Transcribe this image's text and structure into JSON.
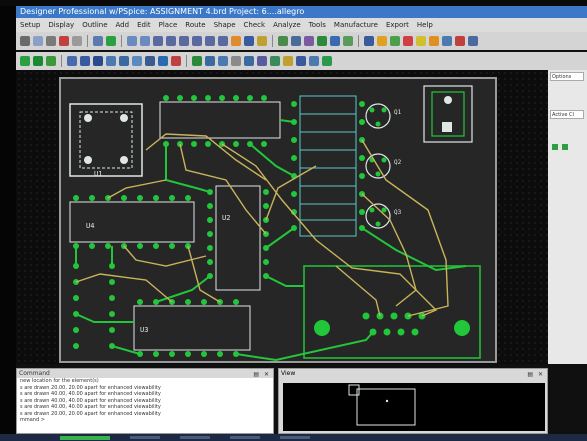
{
  "window": {
    "title": "Designer Professional w/PSpice: ASSIGNMENT 4.brd  Project: 6....allegro"
  },
  "menu": [
    "Setup",
    "Display",
    "Outline",
    "Add",
    "Edit",
    "Place",
    "Route",
    "Shape",
    "Check",
    "Analyze",
    "Tools",
    "Manufacture",
    "Export",
    "Help"
  ],
  "board": {
    "ref_u1": "U1",
    "ref_u2": "U2",
    "ref_u3": "U3",
    "ref_u4": "U4",
    "ref_q1": "Q1",
    "ref_q2": "Q2",
    "ref_q3": "Q3",
    "colors": {
      "copper": "#22c63a",
      "trace": "#c9b45a",
      "silk": "#dfe6e6",
      "board": "#2a2a2a"
    }
  },
  "right_panel": {
    "tabs": [
      "Options",
      "Active Cl"
    ]
  },
  "command_panel": {
    "title": "Command",
    "lines": [
      "new location for the element(s)",
      "s are drawn 20.00, 20.00 apart for enhanced viewability",
      "s are drawn 40.00, 40.00 apart for enhanced viewability",
      "s are drawn 40.00, 40.00 apart for enhanced viewability",
      "s are drawn 40.00, 40.00 apart for enhanced viewability",
      "s are drawn 20.00, 20.00 apart for enhanced viewability",
      "mmand >"
    ]
  },
  "view_panel": {
    "title": "View"
  }
}
